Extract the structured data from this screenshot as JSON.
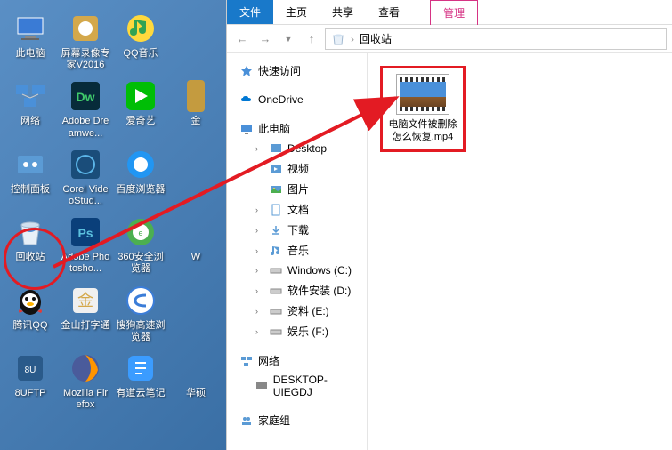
{
  "desktop": {
    "icons": [
      {
        "label": "此电脑",
        "type": "pc"
      },
      {
        "label": "屏幕录像专家V2016",
        "type": "app"
      },
      {
        "label": "QQ音乐",
        "type": "music"
      },
      {
        "label": "",
        "type": "blank"
      },
      {
        "label": "网络",
        "type": "network"
      },
      {
        "label": "Adobe Dreamwe...",
        "type": "dw"
      },
      {
        "label": "爱奇艺",
        "type": "iqiyi"
      },
      {
        "label": "金",
        "type": "partial"
      },
      {
        "label": "控制面板",
        "type": "control"
      },
      {
        "label": "Corel VideoStud...",
        "type": "corel"
      },
      {
        "label": "百度浏览器",
        "type": "baidu"
      },
      {
        "label": "",
        "type": "blank"
      },
      {
        "label": "回收站",
        "type": "recycle"
      },
      {
        "label": "Adobe Photosho...",
        "type": "ps"
      },
      {
        "label": "360安全浏览器",
        "type": "360"
      },
      {
        "label": "W",
        "type": "partial"
      },
      {
        "label": "腾讯QQ",
        "type": "qq"
      },
      {
        "label": "金山打字通",
        "type": "jinshan"
      },
      {
        "label": "搜狗高速浏览器",
        "type": "sogou"
      },
      {
        "label": "",
        "type": "blank"
      },
      {
        "label": "8UFTP",
        "type": "ftp"
      },
      {
        "label": "Mozilla Firefox",
        "type": "firefox"
      },
      {
        "label": "有道云笔记",
        "type": "youdao"
      },
      {
        "label": "华硕",
        "type": "partial"
      }
    ]
  },
  "explorer": {
    "tabs": {
      "file": "文件",
      "home": "主页",
      "share": "共享",
      "view": "查看",
      "manage": "管理"
    },
    "breadcrumb": {
      "location": "回收站"
    },
    "sidebar": {
      "quickaccess": "快速访问",
      "onedrive": "OneDrive",
      "thispc": "此电脑",
      "desktop": "Desktop",
      "videos": "视频",
      "pictures": "图片",
      "documents": "文档",
      "downloads": "下载",
      "music": "音乐",
      "drive_c": "Windows (C:)",
      "drive_d": "软件安装 (D:)",
      "drive_e": "资料 (E:)",
      "drive_f": "娱乐 (F:)",
      "network": "网络",
      "computer": "DESKTOP-UIEGDJ",
      "homegroup": "家庭组"
    },
    "file": {
      "name": "电脑文件被删除怎么恢复.mp4"
    }
  },
  "colors": {
    "highlight": "#e31b23",
    "tab_active": "#1979ca"
  }
}
